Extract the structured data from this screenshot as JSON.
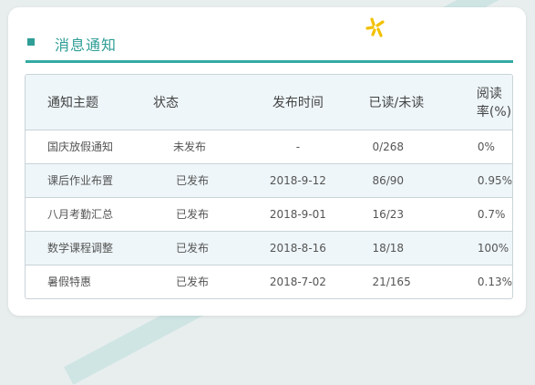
{
  "panel": {
    "title": "消息通知"
  },
  "table": {
    "headers": [
      "通知主题",
      "状态",
      "发布时间",
      "已读/未读",
      "阅读率(%)"
    ],
    "rows": [
      {
        "topic": "国庆放假通知",
        "status": "未发布",
        "time": "-",
        "read": "0/268",
        "rate": "0%"
      },
      {
        "topic": "课后作业布置",
        "status": "已发布",
        "time": "2018-9-12",
        "read": "86/90",
        "rate": "0.95%"
      },
      {
        "topic": "八月考勤汇总",
        "status": "已发布",
        "time": "2018-9-01",
        "read": "16/23",
        "rate": "0.7%"
      },
      {
        "topic": "数学课程调整",
        "status": "已发布",
        "time": "2018-8-16",
        "read": "18/18",
        "rate": "100%"
      },
      {
        "topic": "暑假特惠",
        "status": "已发布",
        "time": "2018-7-02",
        "read": "21/165",
        "rate": "0.13%"
      }
    ]
  },
  "colors": {
    "accent": "#2e9e96",
    "spark": "#f2c100"
  }
}
